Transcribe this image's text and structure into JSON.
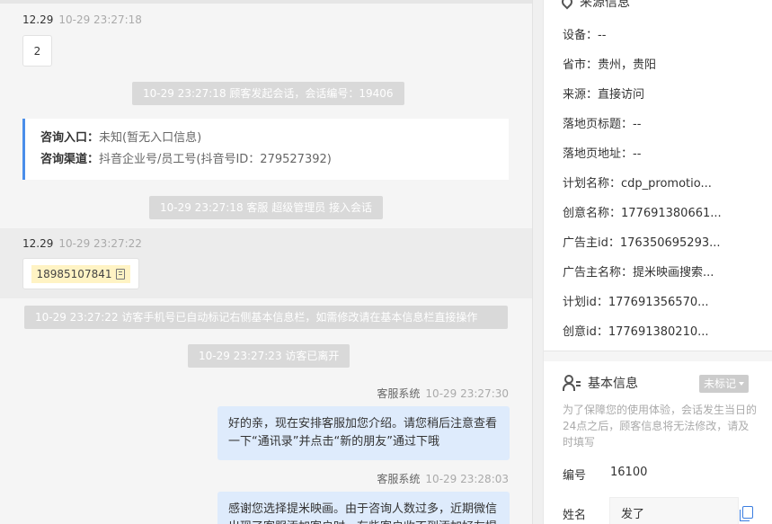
{
  "chat": {
    "visitor_msg_1": {
      "name": "12.29",
      "time": "10-29 23:27:18",
      "text": "2"
    },
    "sys_start": "10-29 23:27:18 顾客发起会话，会话编号：19406",
    "entry": {
      "k1": "咨询入口：",
      "v1": "未知(暂无入口信息)",
      "k2": "咨询渠道：",
      "v2": "抖音企业号/员工号(抖音号ID：279527392)"
    },
    "sys_join": "10-29 23:27:18 客服 超级管理员 接入会话",
    "visitor_msg_2": {
      "name": "12.29",
      "time": "10-29 23:27:22",
      "phone": "18985107841"
    },
    "sys_phone": "10-29 23:27:22 访客手机号已自动标记右侧基本信息栏，如需修改请在基本信息栏直接操作",
    "sys_left": "10-29 23:27:23 访客已离开",
    "agent_msg_1": {
      "name": "客服系统",
      "time": "10-29 23:27:30",
      "text": "好的亲，现在安排客服加您介绍。请您稍后注意查看一下“通讯录”并点击“新的朋友”通过下哦"
    },
    "agent_msg_2": {
      "name": "客服系统",
      "time": "10-29 23:28:03",
      "text": "感谢您选择提米映画。由于咨询人数过多，近期微信出现了客服添加客户时，有些客户收不到添加好友提"
    }
  },
  "source": {
    "title": "来源信息",
    "rows": [
      "设备：--",
      "省市：贵州，贵阳",
      "来源：直接访问",
      "落地页标题：--",
      "落地页地址：--",
      "计划名称：cdp_promotio...",
      "创意名称：177691380661...",
      "广告主id：176350695293...",
      "广告主名称：提米映画搜索...",
      "计划id：177691356570...",
      "创意id：177691380210..."
    ]
  },
  "basic": {
    "title": "基本信息",
    "tag": "未标记",
    "hint": "为了保障您的使用体验，会话发生当日的24点之后，顾客信息将无法修改，请及时填写",
    "id_label": "编号",
    "id_value": "16100",
    "name_label": "姓名",
    "name_value": "发了"
  }
}
